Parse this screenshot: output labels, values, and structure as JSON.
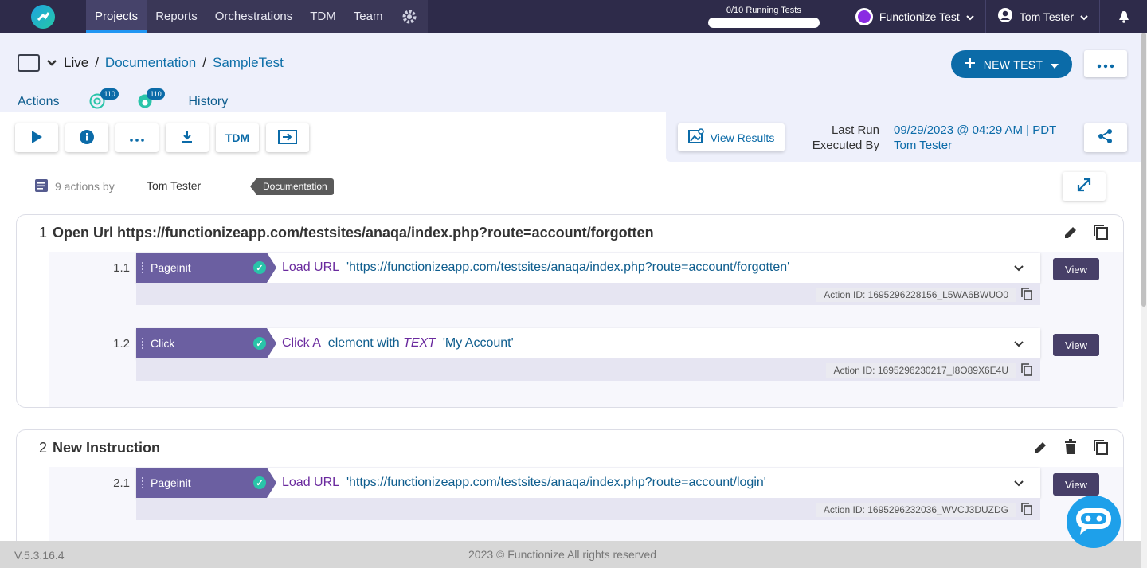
{
  "topnav": {
    "items": [
      "Projects",
      "Reports",
      "Orchestrations",
      "TDM",
      "Team"
    ],
    "active": "Projects",
    "running_tests": "0/10 Running Tests",
    "project": "Functionize Test",
    "user": "Tom Tester"
  },
  "breadcrumb": {
    "env": "Live",
    "sep": "/",
    "project": "Documentation",
    "test": "SampleTest"
  },
  "header": {
    "new_test": "NEW TEST"
  },
  "tabs": {
    "actions": "Actions",
    "chrome_count": "110",
    "edge_count": "110",
    "history": "History"
  },
  "toolbar": {
    "tdm": "TDM",
    "view_results": "View Results"
  },
  "run_info": {
    "last_run_label": "Last Run",
    "last_run_value": "09/29/2023 @ 04:29 AM | PDT",
    "executed_by_label": "Executed By",
    "executed_by_value": "Tom Tester"
  },
  "summary": {
    "count": "9 actions by",
    "author": "Tom Tester",
    "tag": "Documentation"
  },
  "steps": [
    {
      "num": "1",
      "title": "Open Url https://functionizeapp.com/testsites/anaqa/index.php?route=account/forgotten",
      "actions": [
        {
          "num": "1.1",
          "type": "Pageinit",
          "kw": "Load URL",
          "text": "'https://functionizeapp.com/testsites/anaqa/index.php?route=account/forgotten'",
          "id": "Action ID: 1695296228156_L5WA6BWUO0",
          "view": "View"
        },
        {
          "num": "1.2",
          "type": "Click",
          "kw": "Click A",
          "mid": "element with",
          "kwi": "TEXT",
          "text": "'My Account'",
          "id": "Action ID: 1695296230217_I8O89X6E4U",
          "view": "View"
        }
      ]
    },
    {
      "num": "2",
      "title": "New Instruction",
      "actions": [
        {
          "num": "2.1",
          "type": "Pageinit",
          "kw": "Load URL",
          "text": "'https://functionizeapp.com/testsites/anaqa/index.php?route=account/login'",
          "id": "Action ID: 1695296232036_WVCJ3DUZDG",
          "view": "View"
        }
      ]
    }
  ],
  "footer": {
    "version": "V.5.3.16.4",
    "copyright": "2023 © Functionize All rights reserved"
  }
}
